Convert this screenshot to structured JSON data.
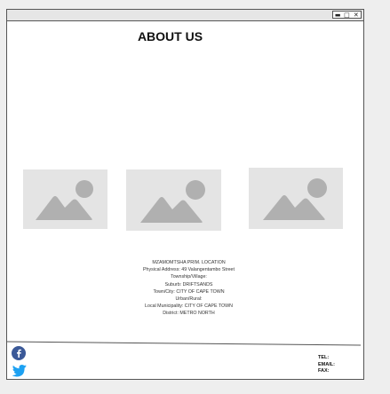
{
  "window": {
    "controls": [
      {
        "name": "minimize-button",
        "glyph": "▬"
      },
      {
        "name": "maximize-button",
        "glyph": "□"
      },
      {
        "name": "close-button",
        "glyph": "✕"
      }
    ]
  },
  "page": {
    "title": "ABOUT US"
  },
  "images": [
    {
      "name": "image-placeholder-1",
      "icon": "image-icon"
    },
    {
      "name": "image-placeholder-2",
      "icon": "image-icon"
    },
    {
      "name": "image-placeholder-3",
      "icon": "image-icon"
    }
  ],
  "address": {
    "lines": [
      "MZAMOMTSHA PRIM. LOCATION",
      "Physical Address: 49 Valangentambo Street",
      "Township/Village:",
      "Suburb: DRIFTSANDS",
      "Town/City: CITY OF CAPE TOWN",
      "Urban/Rural:",
      "Local Municipality: CITY OF CAPE TOWN",
      "District: METRO NORTH"
    ]
  },
  "footer": {
    "social": [
      {
        "name": "facebook-icon",
        "color": "#3b5998"
      },
      {
        "name": "twitter-icon",
        "color": "#1da1f2"
      }
    ],
    "contact": {
      "tel": "TEL:",
      "email": "EMAIL:",
      "fax": "FAX:"
    }
  },
  "colors": {
    "placeholder_bg": "#e4e4e4",
    "placeholder_fg": "#b0b0b0"
  }
}
